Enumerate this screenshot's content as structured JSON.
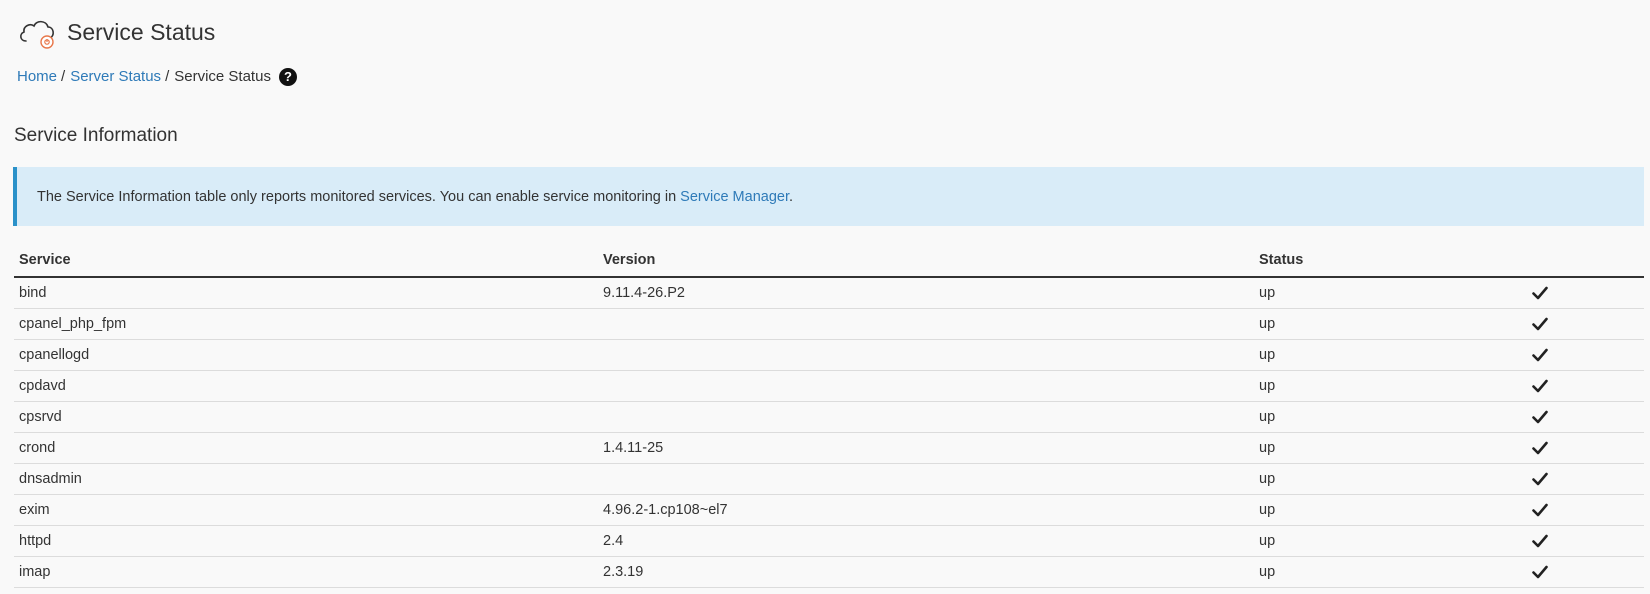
{
  "header": {
    "title": "Service Status",
    "icon": "cloud-gear-icon"
  },
  "breadcrumb": {
    "items": [
      {
        "label": "Home",
        "link": true
      },
      {
        "label": "Server Status",
        "link": true
      },
      {
        "label": "Service Status",
        "link": false
      }
    ],
    "separator": "/",
    "help_icon": "question-circle-icon",
    "help_glyph": "?"
  },
  "section": {
    "title": "Service Information"
  },
  "callout": {
    "text": "The Service Information table only reports monitored services. You can enable service monitoring in ",
    "link_text": "Service Manager",
    "suffix": "."
  },
  "table": {
    "columns": [
      "Service",
      "Version",
      "Status",
      ""
    ],
    "rows": [
      {
        "service": "bind",
        "version": "9.11.4-26.P2",
        "status": "up",
        "icon": "check-icon"
      },
      {
        "service": "cpanel_php_fpm",
        "version": "",
        "status": "up",
        "icon": "check-icon"
      },
      {
        "service": "cpanellogd",
        "version": "",
        "status": "up",
        "icon": "check-icon"
      },
      {
        "service": "cpdavd",
        "version": "",
        "status": "up",
        "icon": "check-icon"
      },
      {
        "service": "cpsrvd",
        "version": "",
        "status": "up",
        "icon": "check-icon"
      },
      {
        "service": "crond",
        "version": "1.4.11-25",
        "status": "up",
        "icon": "check-icon"
      },
      {
        "service": "dnsadmin",
        "version": "",
        "status": "up",
        "icon": "check-icon"
      },
      {
        "service": "exim",
        "version": "4.96.2-1.cp108~el7",
        "status": "up",
        "icon": "check-icon"
      },
      {
        "service": "httpd",
        "version": "2.4",
        "status": "up",
        "icon": "check-icon"
      },
      {
        "service": "imap",
        "version": "2.3.19",
        "status": "up",
        "icon": "check-icon"
      }
    ]
  },
  "colors": {
    "link": "#2e7ab8",
    "callout_bg": "#d9ecf8",
    "callout_border": "#2a91c9",
    "page_bg": "#f9f9f9",
    "app_icon_accent": "#e8774a"
  }
}
